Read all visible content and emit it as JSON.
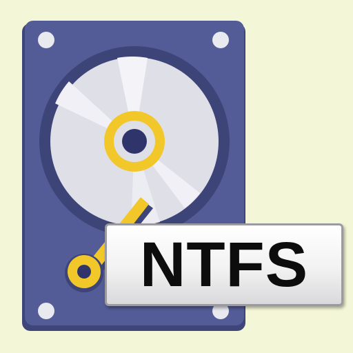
{
  "badge": {
    "text": "NTFS"
  },
  "icon": {
    "name": "hard-drive-icon",
    "colors": {
      "background": "#f4f6d8",
      "case": "#535c97",
      "case_rim": "#3e4579",
      "platter": "#dfdfe8",
      "platter_shine": "#f4f4f8",
      "spindle_ring": "#f2c72a",
      "spindle_center": "#2f356a",
      "arm": "#f2c72a",
      "screw": "#e9e9f0"
    }
  }
}
